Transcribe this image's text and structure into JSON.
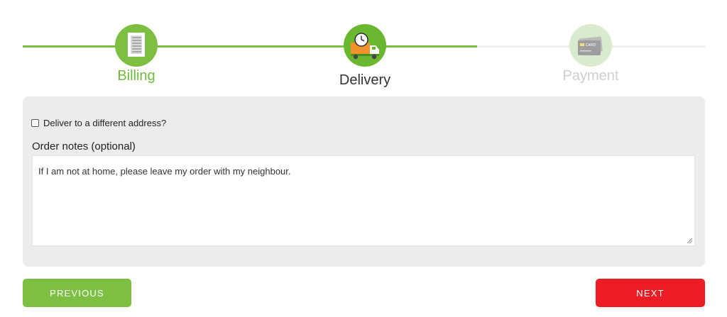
{
  "steps": [
    {
      "label": "Billing",
      "icon": "document-list-icon",
      "state": "complete"
    },
    {
      "label": "Delivery",
      "icon": "delivery-truck-icon",
      "state": "active"
    },
    {
      "label": "Payment",
      "icon": "credit-card-icon",
      "state": "upcoming",
      "card_text": "CARD"
    }
  ],
  "progress": {
    "fraction": 0.666
  },
  "form": {
    "different_address_label": "Deliver to a different address?",
    "different_address_checked": false,
    "notes_label": "Order notes (optional)",
    "notes_value": "If I am not at home, please leave my order with my neighbour."
  },
  "buttons": {
    "previous_label": "PREVIOUS",
    "next_label": "NEXT"
  },
  "colors": {
    "accent_green": "#7cbf43",
    "next_red": "#ec1c24",
    "panel_gray": "#ececec"
  }
}
